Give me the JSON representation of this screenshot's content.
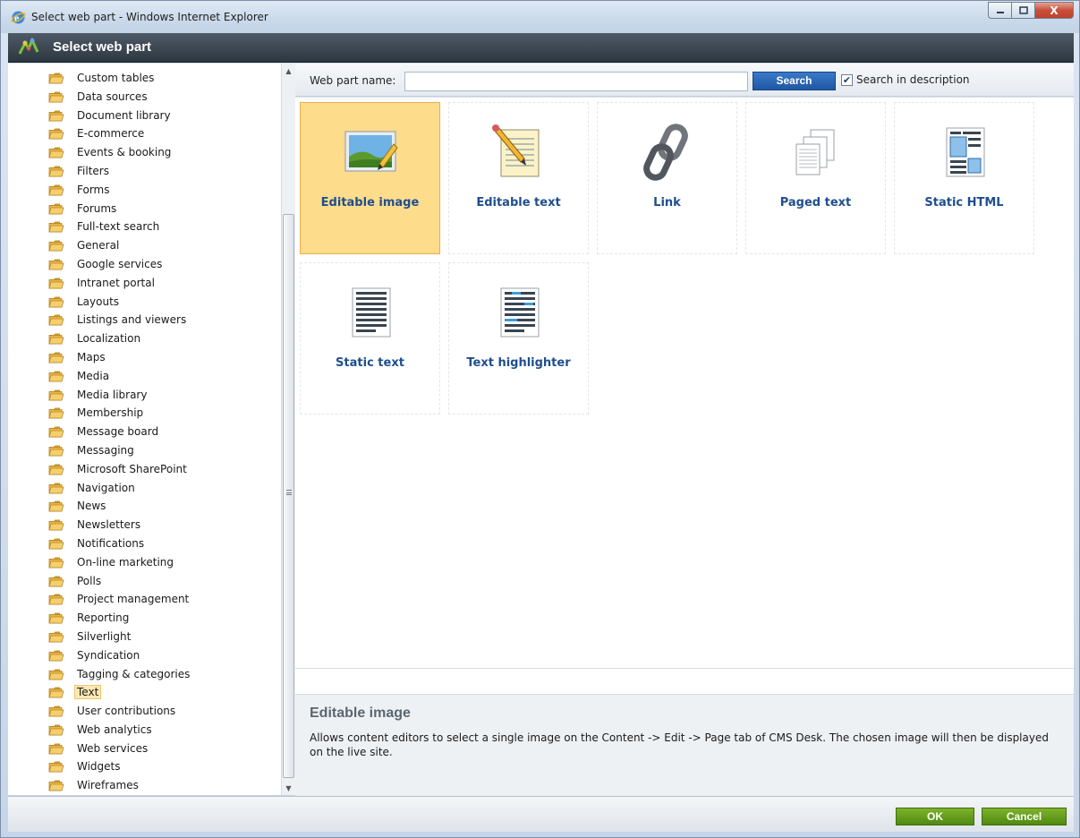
{
  "window": {
    "title": "Select web part - Windows Internet Explorer",
    "minimize_icon": "minimize-icon",
    "maximize_icon": "maximize-icon",
    "close_label": "X"
  },
  "header": {
    "title": "Select web part"
  },
  "tree": {
    "items": [
      {
        "label": "Custom tables",
        "expandable": false
      },
      {
        "label": "Data sources",
        "expandable": true
      },
      {
        "label": "Document library",
        "expandable": false
      },
      {
        "label": "E-commerce",
        "expandable": true
      },
      {
        "label": "Events & booking",
        "expandable": false
      },
      {
        "label": "Filters",
        "expandable": false
      },
      {
        "label": "Forms",
        "expandable": false
      },
      {
        "label": "Forums",
        "expandable": true
      },
      {
        "label": "Full-text search",
        "expandable": true
      },
      {
        "label": "General",
        "expandable": true
      },
      {
        "label": "Google services",
        "expandable": false
      },
      {
        "label": "Intranet portal",
        "expandable": false
      },
      {
        "label": "Layouts",
        "expandable": false
      },
      {
        "label": "Listings and viewers",
        "expandable": true
      },
      {
        "label": "Localization",
        "expandable": false
      },
      {
        "label": "Maps",
        "expandable": true
      },
      {
        "label": "Media",
        "expandable": false
      },
      {
        "label": "Media library",
        "expandable": false
      },
      {
        "label": "Membership",
        "expandable": true
      },
      {
        "label": "Message board",
        "expandable": false
      },
      {
        "label": "Messaging",
        "expandable": false
      },
      {
        "label": "Microsoft SharePoint",
        "expandable": false
      },
      {
        "label": "Navigation",
        "expandable": false
      },
      {
        "label": "News",
        "expandable": false
      },
      {
        "label": "Newsletters",
        "expandable": false
      },
      {
        "label": "Notifications",
        "expandable": false
      },
      {
        "label": "On-line marketing",
        "expandable": false
      },
      {
        "label": "Polls",
        "expandable": false
      },
      {
        "label": "Project management",
        "expandable": false
      },
      {
        "label": "Reporting",
        "expandable": false
      },
      {
        "label": "Silverlight",
        "expandable": false
      },
      {
        "label": "Syndication",
        "expandable": true
      },
      {
        "label": "Tagging & categories",
        "expandable": false
      },
      {
        "label": "Text",
        "expandable": false,
        "selected": true
      },
      {
        "label": "User contributions",
        "expandable": false
      },
      {
        "label": "Web analytics",
        "expandable": false
      },
      {
        "label": "Web services",
        "expandable": false
      },
      {
        "label": "Widgets",
        "expandable": false
      },
      {
        "label": "Wireframes",
        "expandable": true
      }
    ]
  },
  "search": {
    "label": "Web part name:",
    "value": "",
    "button_label": "Search",
    "in_description_checked": true,
    "in_description_label": "Search in description"
  },
  "webparts": [
    {
      "label": "Editable image",
      "icon": "editable-image-icon",
      "selected": true
    },
    {
      "label": "Editable text",
      "icon": "editable-text-icon",
      "selected": false
    },
    {
      "label": "Link",
      "icon": "link-icon",
      "selected": false
    },
    {
      "label": "Paged text",
      "icon": "paged-text-icon",
      "selected": false
    },
    {
      "label": "Static HTML",
      "icon": "static-html-icon",
      "selected": false
    },
    {
      "label": "Static text",
      "icon": "static-text-icon",
      "selected": false
    },
    {
      "label": "Text highlighter",
      "icon": "text-highlighter-icon",
      "selected": false
    }
  ],
  "description": {
    "title": "Editable image",
    "text": "Allows content editors to select a single image on the Content -> Edit -> Page tab of CMS Desk. The chosen image will then be displayed on the live site."
  },
  "footer": {
    "ok_label": "OK",
    "cancel_label": "Cancel"
  },
  "colors": {
    "selected_tile": "#fddc8c",
    "header_dark": "#3a444f",
    "ok_green": "#5f9a18",
    "link_blue": "#1f4e8e"
  }
}
